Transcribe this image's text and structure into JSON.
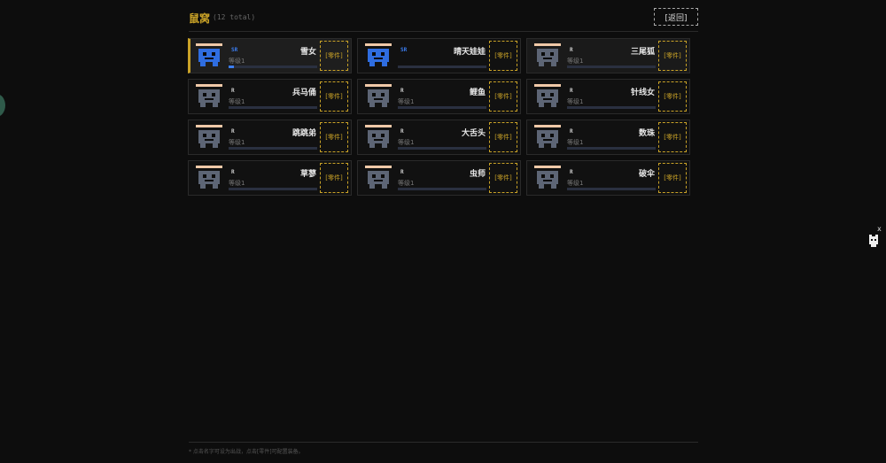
{
  "header": {
    "title": "鼠窝",
    "count": "(12 total)",
    "back_label": "[返回]"
  },
  "characters": [
    {
      "name": "雪女",
      "rarity": "SR",
      "level": "等级1",
      "progress": 0.06,
      "parts_label": "[零件]",
      "state": "active",
      "sprite": "blue-snow"
    },
    {
      "name": "晴天娃娃",
      "rarity": "SR",
      "level": "",
      "progress": 0,
      "parts_label": "[零件]",
      "state": "normal",
      "sprite": "blue-doll"
    },
    {
      "name": "三尾狐",
      "rarity": "R",
      "level": "等级1",
      "progress": 0,
      "parts_label": "[零件]",
      "state": "dim",
      "sprite": "gray-fox"
    },
    {
      "name": "兵马俑",
      "rarity": "R",
      "level": "等级1",
      "progress": 0,
      "parts_label": "[零件]",
      "state": "normal",
      "sprite": "gray-a"
    },
    {
      "name": "鲤鱼",
      "rarity": "R",
      "level": "等级1",
      "progress": 0,
      "parts_label": "[零件]",
      "state": "normal",
      "sprite": "gray-b"
    },
    {
      "name": "针线女",
      "rarity": "R",
      "level": "等级1",
      "progress": 0,
      "parts_label": "[零件]",
      "state": "normal",
      "sprite": "gray-c"
    },
    {
      "name": "跳跳弟",
      "rarity": "R",
      "level": "等级1",
      "progress": 0,
      "parts_label": "[零件]",
      "state": "normal",
      "sprite": "gray-d"
    },
    {
      "name": "大舌头",
      "rarity": "R",
      "level": "等级1",
      "progress": 0,
      "parts_label": "[零件]",
      "state": "normal",
      "sprite": "gray-e"
    },
    {
      "name": "数珠",
      "rarity": "R",
      "level": "等级1",
      "progress": 0,
      "parts_label": "[零件]",
      "state": "normal",
      "sprite": "gray-f"
    },
    {
      "name": "草蓼",
      "rarity": "R",
      "level": "等级1",
      "progress": 0,
      "parts_label": "[零件]",
      "state": "normal",
      "sprite": "gray-g"
    },
    {
      "name": "虫师",
      "rarity": "R",
      "level": "等级1",
      "progress": 0,
      "parts_label": "[零件]",
      "state": "normal",
      "sprite": "gray-h"
    },
    {
      "name": "破伞",
      "rarity": "R",
      "level": "等级1",
      "progress": 0,
      "parts_label": "[零件]",
      "state": "normal",
      "sprite": "gray-i"
    }
  ],
  "footer": {
    "hint": "* 点击名字可设为出战，点击[零件]可配置装备。"
  },
  "widget": {
    "close_label": "x",
    "icon": "cat-icon"
  },
  "colors": {
    "accent": "#c9a227",
    "sr": "#3b7df0",
    "background": "#0d0d0d",
    "card": "#111111"
  }
}
